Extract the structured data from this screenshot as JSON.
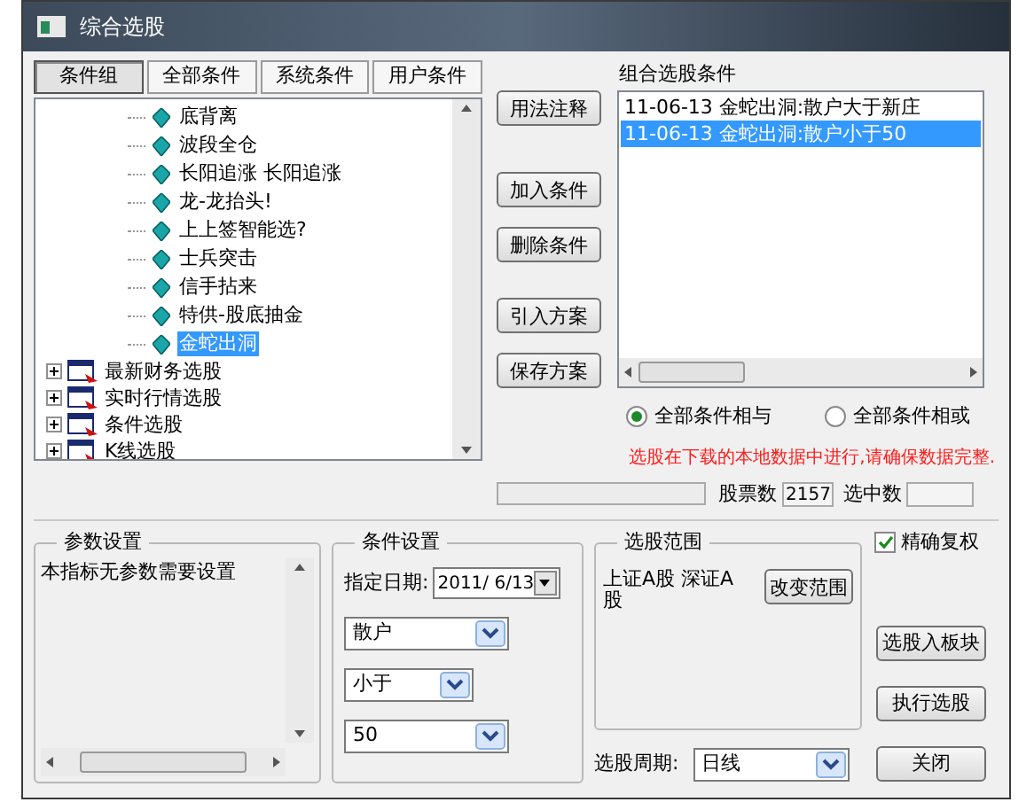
{
  "window": {
    "title": "综合选股"
  },
  "tabs": [
    {
      "label": "条件组",
      "selected": true
    },
    {
      "label": "全部条件",
      "selected": false
    },
    {
      "label": "系统条件",
      "selected": false
    },
    {
      "label": "用户条件",
      "selected": false
    }
  ],
  "tree": {
    "leaves": [
      {
        "label": "底背离",
        "selected": false
      },
      {
        "label": "波段全仓",
        "selected": false
      },
      {
        "label": "长阳追涨 长阳追涨",
        "selected": false
      },
      {
        "label": "龙-龙抬头!",
        "selected": false
      },
      {
        "label": "上上签智能选?",
        "selected": false
      },
      {
        "label": "士兵突击",
        "selected": false
      },
      {
        "label": "信手拈来",
        "selected": false
      },
      {
        "label": "特供-股底抽金",
        "selected": false
      },
      {
        "label": "金蛇出洞",
        "selected": true
      }
    ],
    "groups": [
      {
        "label": "最新财务选股",
        "expanded": false
      },
      {
        "label": "实时行情选股",
        "expanded": false
      },
      {
        "label": "条件选股",
        "expanded": false
      },
      {
        "label": "K线选股",
        "expanded": false
      }
    ]
  },
  "side_buttons": [
    "用法注释",
    "加入条件",
    "删除条件",
    "引入方案",
    "保存方案"
  ],
  "conditions": {
    "title": "组合选股条件",
    "items": [
      {
        "text": "11-06-13 金蛇出洞:散户大于新庄",
        "selected": false
      },
      {
        "text": "11-06-13 金蛇出洞:散户小于50",
        "selected": true
      }
    ]
  },
  "logic": [
    {
      "label": "全部条件相与",
      "selected": true
    },
    {
      "label": "全部条件相或",
      "selected": false
    }
  ],
  "notice": "选股在下载的本地数据中进行,请确保数据完整.",
  "status": {
    "stock_count_label": "股票数",
    "stock_count": "2157",
    "selected_count_label": "选中数"
  },
  "params": {
    "title": "参数设置",
    "text": "本指标无参数需要设置"
  },
  "condition_settings": {
    "title": "条件设置",
    "date_label": "指定日期:",
    "date": "2011/ 6/13",
    "dropdowns": [
      "散户",
      "小于",
      "50"
    ]
  },
  "range": {
    "title": "选股范围",
    "text": "上证A股 深证A股",
    "button": "改变范围",
    "period_label": "选股周期:",
    "period": "日线"
  },
  "exact_restore": {
    "label": "精确复权",
    "checked": true
  },
  "action_buttons": [
    "选股入板块",
    "执行选股",
    "关闭"
  ]
}
